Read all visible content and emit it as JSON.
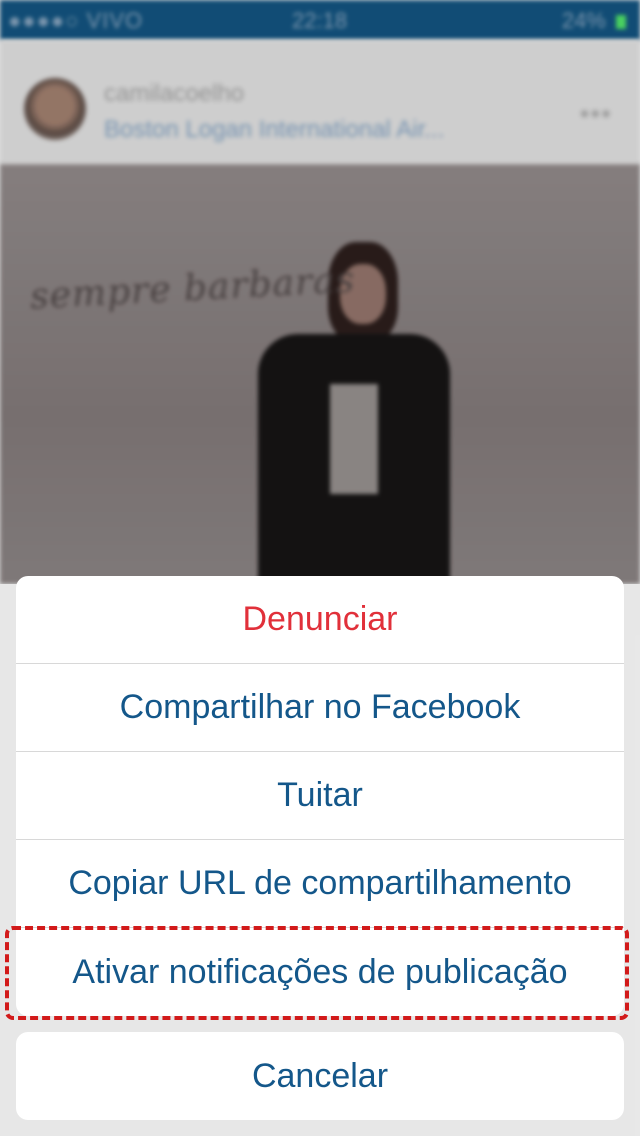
{
  "status_bar": {
    "carrier": "●●●●○ VIVO",
    "time": "22:18",
    "battery": "24%"
  },
  "post": {
    "username": "camilacoelho",
    "location": "Boston Logan International Air...",
    "photo_caption": "sempre barbaras"
  },
  "action_sheet": {
    "items": [
      {
        "label": "Denunciar"
      },
      {
        "label": "Compartilhar no Facebook"
      },
      {
        "label": "Tuitar"
      },
      {
        "label": "Copiar URL de compartilhamento"
      },
      {
        "label": "Ativar notificações de publicação"
      }
    ],
    "cancel_label": "Cancelar"
  },
  "colors": {
    "action_text": "#14578a",
    "destructive_text": "#e1303a",
    "highlight_border": "#d21a1a"
  }
}
